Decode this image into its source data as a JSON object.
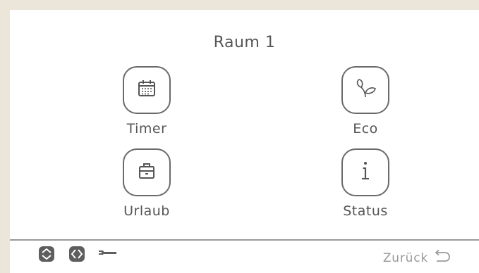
{
  "screen": {
    "title": "Raum 1"
  },
  "menu": {
    "items": [
      {
        "label": "Timer",
        "icon": "calendar-icon"
      },
      {
        "label": "Eco",
        "icon": "leaf-icon"
      },
      {
        "label": "Urlaub",
        "icon": "suitcase-icon"
      },
      {
        "label": "Status",
        "icon": "info-icon"
      }
    ]
  },
  "footer": {
    "icons": [
      "up-down-arrows-icon",
      "left-right-arrows-icon",
      "wrench-icon"
    ],
    "back_label": "Zurück"
  },
  "colors": {
    "background_frame": "#ebe5da",
    "screen": "#ffffff",
    "text": "#555555",
    "muted_text": "#999999",
    "icon_stroke": "#6a6a6a"
  }
}
